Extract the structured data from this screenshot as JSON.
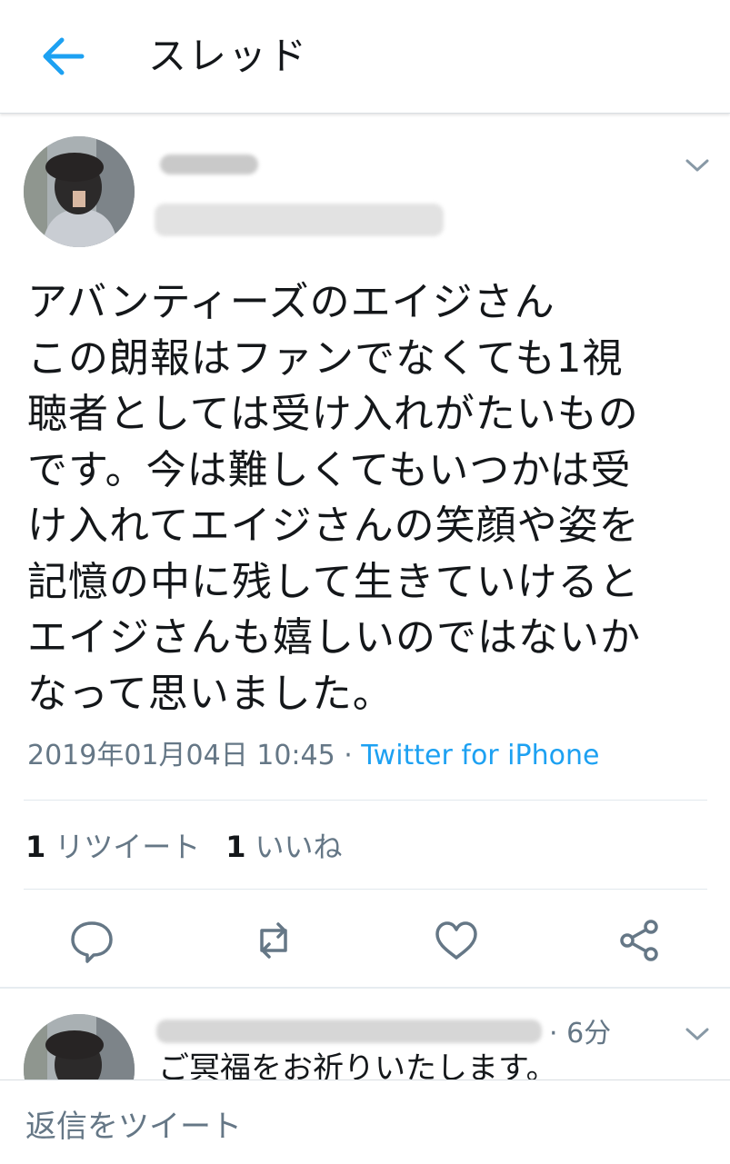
{
  "header": {
    "title": "スレッド",
    "back_icon": "arrow-left-icon",
    "accent": "#1da1f2"
  },
  "tweet": {
    "text": "アバンティーズのエイジさん\nこの朗報はファンでなくても1視\n聴者としては受け入れがたいもの\nです。今は難しくてもいつかは受\nけ入れてエイジさんの笑顔や姿を\n記憶の中に残して生きていけると\nエイジさんも嬉しいのではないか\nなって思いました。",
    "timestamp": "2019年01月04日 10:45",
    "separator": " · ",
    "source": "Twitter for iPhone",
    "retweet_count": "1",
    "retweet_label": "リツイート",
    "like_count": "1",
    "like_label": "いいね",
    "actions": [
      "reply-icon",
      "retweet-icon",
      "like-icon",
      "share-icon"
    ]
  },
  "reply": {
    "time": "· 6分",
    "text": "ご冥福をお祈りいたします。"
  },
  "reply_bar": {
    "placeholder": "返信をツイート"
  }
}
